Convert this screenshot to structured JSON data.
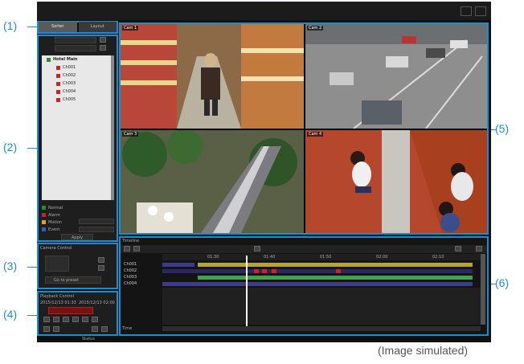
{
  "callouts": [
    "(1)",
    "(2)",
    "(3)",
    "(4)",
    "(5)",
    "(6)"
  ],
  "caption": "(Image simulated)",
  "colors": {
    "accent": "#1a8fd0",
    "app_bg": "#101010",
    "timeline_yellow": "#b5a631",
    "timeline_purple": "#3e3a8c",
    "timeline_green": "#3ca54a",
    "timeline_red": "#d61b2b"
  },
  "tabs": {
    "tab1": "Sorter",
    "tab2": "Layout"
  },
  "camera_tree": {
    "root": "Hotel Main",
    "items": [
      "Ch001",
      "Ch002",
      "Ch003",
      "Ch004",
      "Ch005"
    ]
  },
  "legend": [
    "Normal",
    "Alarm",
    "Motion",
    "Event"
  ],
  "panel2_button": "Apply",
  "panel3": {
    "title": "Camera Control",
    "button": "Go to preset"
  },
  "panel4": {
    "title": "Playback Control",
    "start": "2015/12/13 01:33",
    "end": "2015/12/13 02:00"
  },
  "videos": [
    {
      "label": "Cam 1",
      "name": "supermarket-aisle"
    },
    {
      "label": "Cam 2",
      "name": "parking-lot"
    },
    {
      "label": "Cam 3",
      "name": "escalator-atrium"
    },
    {
      "label": "Cam 4",
      "name": "overhead-lobby"
    }
  ],
  "timeline": {
    "title": "Timeline",
    "ticks": [
      "01:30",
      "01:40",
      "01:50",
      "02:00",
      "02:10"
    ],
    "rows": [
      "Ch001",
      "Ch002",
      "Ch003",
      "Ch004"
    ]
  },
  "status_left": "Status",
  "status_bottom": "Time"
}
